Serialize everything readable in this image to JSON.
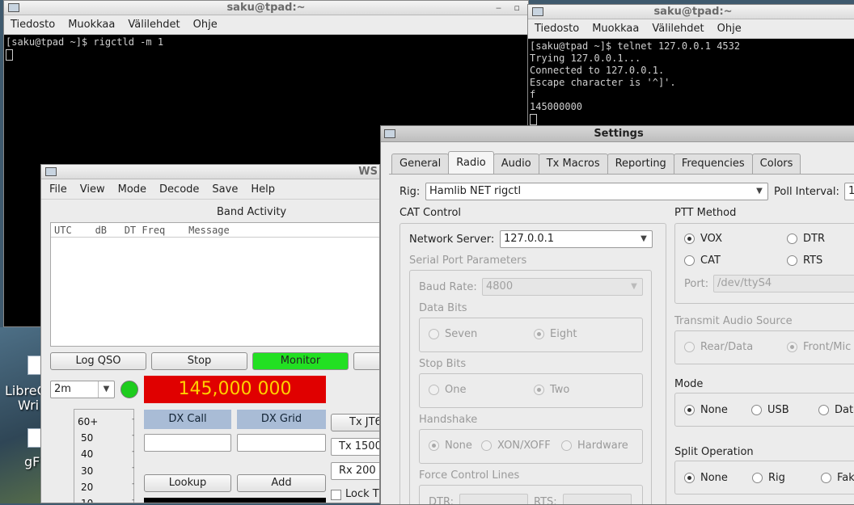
{
  "term_left": {
    "title": "saku@tpad:~",
    "menu": [
      "Tiedosto",
      "Muokkaa",
      "Välilehdet",
      "Ohje"
    ],
    "lines": [
      "[saku@tpad ~]$ rigctld -m 1"
    ]
  },
  "term_right": {
    "title": "saku@tpad:~",
    "menu": [
      "Tiedosto",
      "Muokkaa",
      "Välilehdet",
      "Ohje"
    ],
    "lines": [
      "[saku@tpad ~]$ telnet 127.0.0.1 4532",
      "Trying 127.0.0.1...",
      "Connected to 127.0.0.1.",
      "Escape character is '^]'.",
      "f",
      "145000000"
    ]
  },
  "desktop": {
    "labels": [
      "LibreO",
      "Wri",
      "gF"
    ]
  },
  "wsjt": {
    "title": "WS",
    "menu": [
      "File",
      "View",
      "Mode",
      "Decode",
      "Save",
      "Help"
    ],
    "band_activity": "Band Activity",
    "band_header": "UTC    dB   DT Freq    Message",
    "log_qso": "Log QSO",
    "stop": "Stop",
    "monitor": "Monitor",
    "band": "2m",
    "frequency": "145,000 000",
    "dx_call": "DX Call",
    "dx_grid": "DX Grid",
    "lookup": "Lookup",
    "add": "Add",
    "tx_mode": "Tx JT6",
    "tx_freq": "Tx  1500",
    "rx_freq": "Rx  200",
    "lock": "Lock T",
    "meter_scale": [
      "60+",
      "50",
      "40",
      "30",
      "20",
      "10"
    ]
  },
  "settings": {
    "title": "Settings",
    "tabs": [
      "General",
      "Radio",
      "Audio",
      "Tx Macros",
      "Reporting",
      "Frequencies",
      "Colors"
    ],
    "active_tab": "Radio",
    "rig_label": "Rig:",
    "rig_value": "Hamlib NET rigctl",
    "poll_label": "Poll Interval:",
    "poll_value": "1",
    "cat_control": "CAT Control",
    "network_server_label": "Network Server:",
    "network_server_value": "127.0.0.1",
    "serial_params": "Serial Port Parameters",
    "baud_label": "Baud Rate:",
    "baud_value": "4800",
    "data_bits": "Data Bits",
    "seven": "Seven",
    "eight": "Eight",
    "stop_bits": "Stop Bits",
    "one": "One",
    "two": "Two",
    "handshake": "Handshake",
    "hs_none": "None",
    "xonxoff": "XON/XOFF",
    "hardware": "Hardware",
    "force_lines": "Force Control Lines",
    "dtr": "DTR:",
    "rts": "RTS:",
    "ptt_method": "PTT Method",
    "vox": "VOX",
    "dtr_opt": "DTR",
    "cat": "CAT",
    "rts_opt": "RTS",
    "port_label": "Port:",
    "port_value": "/dev/ttyS4",
    "tx_audio_source": "Transmit Audio Source",
    "rear_data": "Rear/Data",
    "front_mic": "Front/Mic",
    "mode": "Mode",
    "mode_none": "None",
    "usb": "USB",
    "data": "Data",
    "split_operation": "Split Operation",
    "split_none": "None",
    "rig": "Rig",
    "fake": "Fak"
  }
}
